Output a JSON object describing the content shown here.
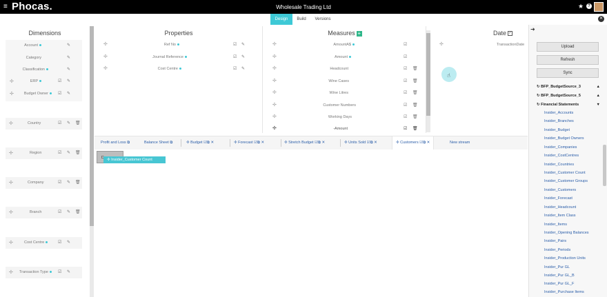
{
  "topbar": {
    "logo": "Phocas.",
    "company": "Wholesale Trading Ltd",
    "menu_icon": "≡",
    "star_icon": "★",
    "help_icon": "?"
  },
  "tabs": [
    {
      "label": "Design",
      "active": true
    },
    {
      "label": "Build",
      "active": false
    },
    {
      "label": "Versions",
      "active": false
    }
  ],
  "dimensions": {
    "title": "Dimensions",
    "group": [
      {
        "label": "Account",
        "dot": true
      },
      {
        "label": "Category",
        "dot": false
      },
      {
        "label": "Classification",
        "dot": true
      },
      {
        "label": "ERP",
        "dot": true
      },
      {
        "label": "Budget Owner",
        "dot": true
      }
    ],
    "items": [
      {
        "label": "Country",
        "dot": false
      },
      {
        "label": "Region",
        "dot": false
      },
      {
        "label": "Company",
        "dot": false
      },
      {
        "label": "Branch",
        "dot": false
      },
      {
        "label": "Cost Centre",
        "dot": true
      },
      {
        "label": "Transaction Type",
        "dot": true
      }
    ]
  },
  "properties": {
    "title": "Properties",
    "items": [
      {
        "label": "Ref No",
        "dot": true
      },
      {
        "label": "Journal Reference",
        "dot": true
      },
      {
        "label": "Cost Centre",
        "dot": true
      }
    ]
  },
  "measures": {
    "title": "Measures",
    "add_icon": "+",
    "items": [
      {
        "label": "AmountA$",
        "dot": true
      },
      {
        "label": "Amount",
        "dot": true
      },
      {
        "label": "Headcount",
        "dot": false
      },
      {
        "label": "Wine Cases",
        "dot": false
      },
      {
        "label": "Wine Litres",
        "dot": false
      },
      {
        "label": "Customer Numbers",
        "dot": false
      },
      {
        "label": "Working Days",
        "dot": false
      },
      {
        "label": "-Amount",
        "dot": false
      }
    ]
  },
  "date": {
    "title": "Date",
    "items": [
      {
        "label": "TransactionDate"
      }
    ]
  },
  "streams": {
    "tabs": [
      {
        "label": "Profit and Loss"
      },
      {
        "label": "Balance Sheet"
      },
      {
        "label": "Budget"
      },
      {
        "label": "Forecast"
      },
      {
        "label": "Stretch Budget"
      },
      {
        "label": "Units Sold"
      },
      {
        "label": "Customers"
      },
      {
        "label": "New stream"
      }
    ],
    "drag_box": "D",
    "drag_chip": "Insider_Customer Count"
  },
  "right_panel": {
    "buttons": [
      "Upload",
      "Refresh",
      "Sync"
    ],
    "sources": [
      {
        "label": "BFP_BudgetSource_3",
        "chevron": "▲"
      },
      {
        "label": "BFP_BudgetSource_5",
        "chevron": "▲"
      },
      {
        "label": "Financial Statements",
        "chevron": "▼"
      }
    ],
    "items": [
      "Insider_Accounts",
      "Insider_Branches",
      "Insider_Budget",
      "Insider_Budget Owners",
      "Insider_Companies",
      "Insider_CostCentres",
      "Insider_Countries",
      "Insider_Customer Count",
      "Insider_Customer Groups",
      "Insider_Customers",
      "Insider_Forecast",
      "Insider_Headcount",
      "Insider_Item Class",
      "Insider_Items",
      "Insider_Opening Balances",
      "Insider_Pairs",
      "Insider_Periods",
      "Insider_Production Units",
      "Insider_Pur GL",
      "Insider_Pur GL_B",
      "Insider_Pur GL_F",
      "Insider_Purchase Items"
    ]
  },
  "colors": {
    "accent": "#3ec9d6",
    "add_green": "#2fb78a",
    "link_blue": "#2a5da8"
  }
}
